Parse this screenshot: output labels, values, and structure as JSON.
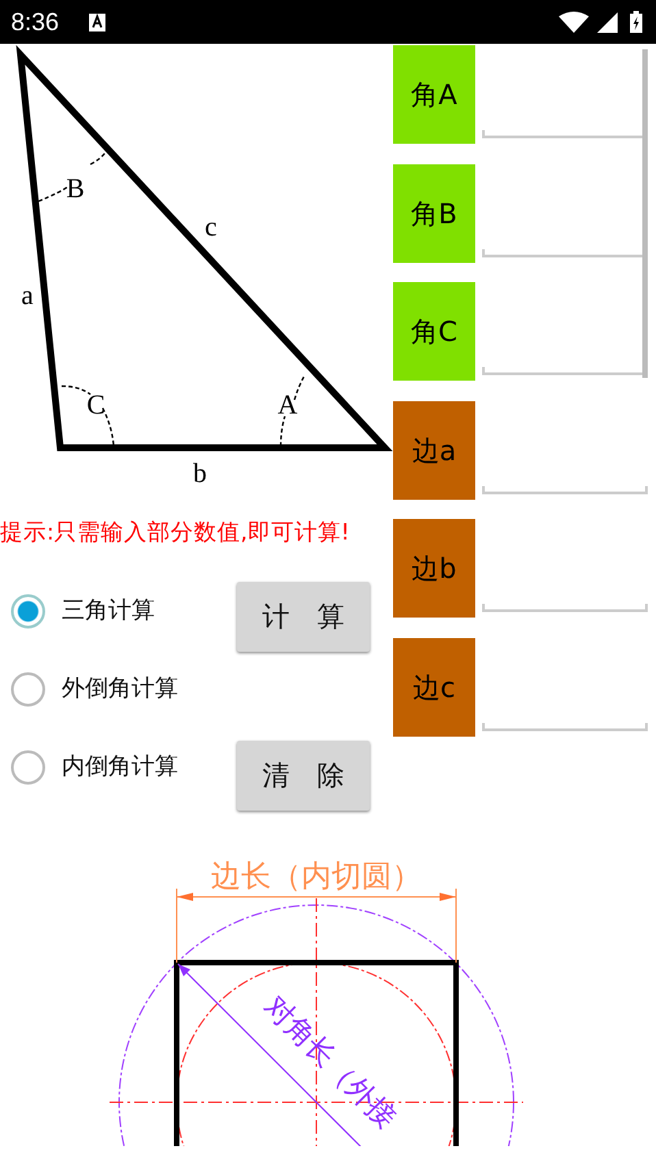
{
  "status_bar": {
    "time": "8:36"
  },
  "triangle": {
    "side_labels": [
      "a",
      "b",
      "c"
    ],
    "angle_labels": [
      "A",
      "B",
      "C"
    ]
  },
  "inputs": [
    {
      "label": "角A",
      "kind": "angle"
    },
    {
      "label": "角B",
      "kind": "angle"
    },
    {
      "label": "角C",
      "kind": "angle"
    },
    {
      "label": "边a",
      "kind": "side"
    },
    {
      "label": "边b",
      "kind": "side"
    },
    {
      "label": "边c",
      "kind": "side"
    }
  ],
  "hint": "提示:只需输入部分数值,即可计算!",
  "modes": [
    {
      "label": "三角计算",
      "selected": true
    },
    {
      "label": "外倒角计算",
      "selected": false
    },
    {
      "label": "内倒角计算",
      "selected": false
    }
  ],
  "buttons": [
    "计 算",
    "清 除"
  ],
  "diagram": {
    "width_label": "边长（内切圆）",
    "diagonal_label": "对角长（外接"
  }
}
